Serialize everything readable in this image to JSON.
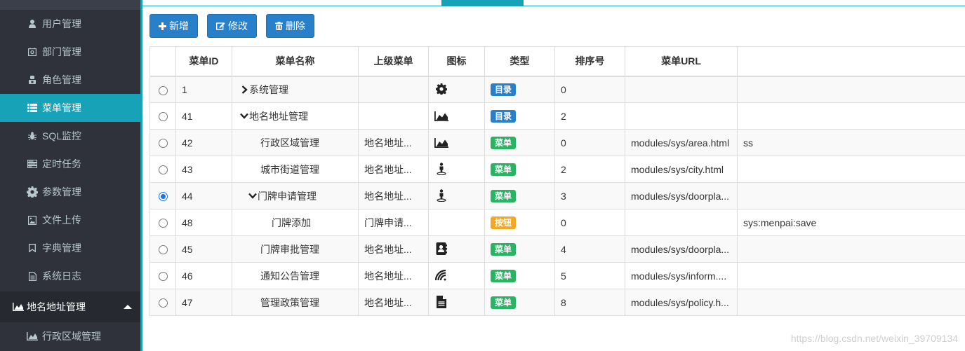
{
  "sidebar": {
    "items": [
      {
        "label": "用户管理",
        "icon": "user-icon",
        "active": false
      },
      {
        "label": "部门管理",
        "icon": "department-icon",
        "active": false
      },
      {
        "label": "角色管理",
        "icon": "role-icon",
        "active": false
      },
      {
        "label": "菜单管理",
        "icon": "list-icon",
        "active": true
      },
      {
        "label": "SQL监控",
        "icon": "bug-icon",
        "active": false
      },
      {
        "label": "定时任务",
        "icon": "tasks-icon",
        "active": false
      },
      {
        "label": "参数管理",
        "icon": "gear-icon",
        "active": false
      },
      {
        "label": "文件上传",
        "icon": "image-file-icon",
        "active": false
      },
      {
        "label": "字典管理",
        "icon": "bookmark-icon",
        "active": false
      },
      {
        "label": "系统日志",
        "icon": "file-text-icon",
        "active": false
      }
    ],
    "group": {
      "label": "地名地址管理",
      "icon": "area-chart-icon"
    },
    "sub_items": [
      {
        "label": "行政区域管理",
        "icon": "area-chart-icon"
      }
    ]
  },
  "toolbar": {
    "add_label": "新增",
    "edit_label": "修改",
    "delete_label": "删除"
  },
  "table": {
    "headers": [
      "",
      "菜单ID",
      "菜单名称",
      "上级菜单",
      "图标",
      "类型",
      "排序号",
      "菜单URL",
      ""
    ],
    "rows": [
      {
        "id": "1",
        "name": "系统管理",
        "expander": "right",
        "indent": 0,
        "parent": "",
        "icon": "gear-icon",
        "type": "目录",
        "order": "0",
        "url": "",
        "perms": "",
        "checked": false
      },
      {
        "id": "41",
        "name": "地名地址管理",
        "expander": "down",
        "indent": 0,
        "parent": "",
        "icon": "area-chart-icon",
        "type": "目录",
        "order": "2",
        "url": "",
        "perms": "",
        "checked": false
      },
      {
        "id": "42",
        "name": "行政区域管理",
        "expander": "",
        "indent": 2,
        "parent": "地名地址...",
        "icon": "area-chart-icon",
        "type": "菜单",
        "order": "0",
        "url": "modules/sys/area.html",
        "perms": "ss",
        "checked": false
      },
      {
        "id": "43",
        "name": "城市街道管理",
        "expander": "",
        "indent": 2,
        "parent": "地名地址...",
        "icon": "street-view-icon",
        "type": "菜单",
        "order": "2",
        "url": "modules/sys/city.html",
        "perms": "",
        "checked": false
      },
      {
        "id": "44",
        "name": "门牌申请管理",
        "expander": "down",
        "indent": 1,
        "parent": "地名地址...",
        "icon": "street-view-icon",
        "type": "菜单",
        "order": "3",
        "url": "modules/sys/doorpla...",
        "perms": "",
        "checked": true
      },
      {
        "id": "48",
        "name": "门牌添加",
        "expander": "",
        "indent": 3,
        "parent": "门牌申请...",
        "icon": "",
        "type": "按钮",
        "order": "0",
        "url": "",
        "perms": "sys:menpai:save",
        "checked": false
      },
      {
        "id": "45",
        "name": "门牌审批管理",
        "expander": "",
        "indent": 2,
        "parent": "地名地址...",
        "icon": "address-book-icon",
        "type": "菜单",
        "order": "4",
        "url": "modules/sys/doorpla...",
        "perms": "",
        "checked": false
      },
      {
        "id": "46",
        "name": "通知公告管理",
        "expander": "",
        "indent": 2,
        "parent": "地名地址...",
        "icon": "signal-icon",
        "type": "菜单",
        "order": "5",
        "url": "modules/sys/inform....",
        "perms": "",
        "checked": false
      },
      {
        "id": "47",
        "name": "管理政策管理",
        "expander": "",
        "indent": 2,
        "parent": "地名地址...",
        "icon": "file-icon",
        "type": "菜单",
        "order": "8",
        "url": "modules/sys/policy.h...",
        "perms": "",
        "checked": false
      }
    ]
  },
  "type_colors": {
    "目录": "#2780c9",
    "菜单": "#28b463",
    "按钮": "#f5a623"
  },
  "watermark": "https://blog.csdn.net/weixin_39709134"
}
